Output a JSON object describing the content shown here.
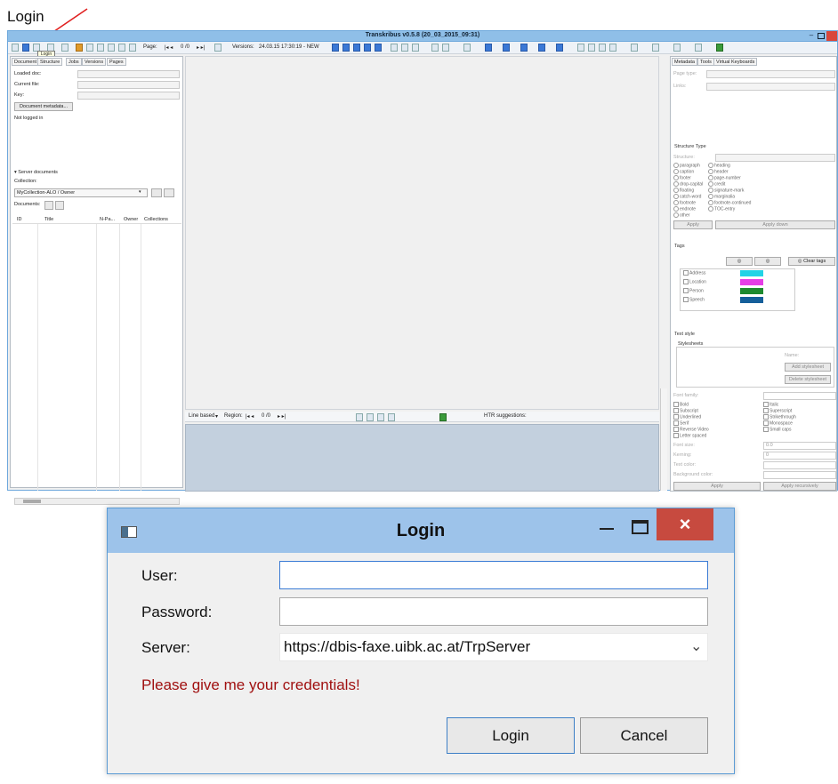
{
  "heading": "Login",
  "app": {
    "title": "Transkribus v0.5.8 (20_03_2015_09:31)",
    "toolbar": {
      "page_label": "Page:",
      "page_counter": "0 /0",
      "versions_label": "Versions:",
      "versions_value": "24.03.15 17:30:19 - NEW"
    },
    "tooltip": "Login",
    "left_tabs": [
      "Document",
      "Structure",
      "Jobs",
      "Versions",
      "Pages"
    ],
    "left": {
      "loaded_doc": "Loaded doc:",
      "current_file": "Current file:",
      "key": "Key:",
      "doc_metadata_btn": "Document metadata...",
      "login_status": "Not logged in",
      "server_documents": "Server documents",
      "collection_label": "Collection:",
      "collection_value": "MyCollection-ALO / Owner",
      "documents_label": "Documents:",
      "columns": [
        "ID",
        "Title",
        "N-Pa...",
        "Owner",
        "Collections"
      ]
    },
    "bottom_toolbar": {
      "mode": "Line based",
      "region_label": "Region:",
      "counter": "0 /0",
      "htr_label": "HTR suggestions:"
    },
    "right_tabs": [
      "Metadata",
      "Tools",
      "Virtual Keyboards"
    ],
    "right": {
      "page_type": "Page type:",
      "links": "Links:",
      "structure_type": "Structure Type",
      "structure": "Structure:",
      "types_col1": [
        "paragraph",
        "caption",
        "footer",
        "drop-capital",
        "floating",
        "catch-word",
        "footnote",
        "endnote",
        "other"
      ],
      "types_col2": [
        "heading",
        "header",
        "page-number",
        "credit",
        "signature-mark",
        "marginalia",
        "footnote-continued",
        "TOC-entry"
      ],
      "apply": "Apply",
      "apply_down": "Apply down",
      "tags_title": "Tags",
      "clear_tags": "Clear tags",
      "tags": [
        {
          "name": "Address",
          "color": "#22d3e6"
        },
        {
          "name": "Location",
          "color": "#e63ee6"
        },
        {
          "name": "Person",
          "color": "#1e8a2e"
        },
        {
          "name": "Speech",
          "color": "#155f9a"
        }
      ],
      "text_style": "Text style",
      "stylesheets": "Stylesheets",
      "name_label": "Name:",
      "add_stylesheet": "Add stylesheet",
      "delete_stylesheet": "Delete stylesheet",
      "font_family": "Font family:",
      "styles_col1": [
        "Bold",
        "Subscript",
        "Underlined",
        "Serif",
        "Reverse Video",
        "Letter spaced"
      ],
      "styles_col2": [
        "Italic",
        "Superscript",
        "Strikethrough",
        "Monospace",
        "Small caps"
      ],
      "font_size": "Font size:",
      "font_size_value": "0.0",
      "kerning": "Kerning:",
      "kerning_value": "0",
      "text_color": "Text color:",
      "background_color": "Background color:",
      "apply_recursively": "Apply recursively"
    }
  },
  "dialog": {
    "title": "Login",
    "close_glyph": "×",
    "user_label": "User:",
    "user_value": "",
    "password_label": "Password:",
    "server_label": "Server:",
    "server_value": "https://dbis-faxe.uibk.ac.at/TrpServer",
    "message": "Please give me your credentials!",
    "login_btn": "Login",
    "cancel_btn": "Cancel"
  }
}
